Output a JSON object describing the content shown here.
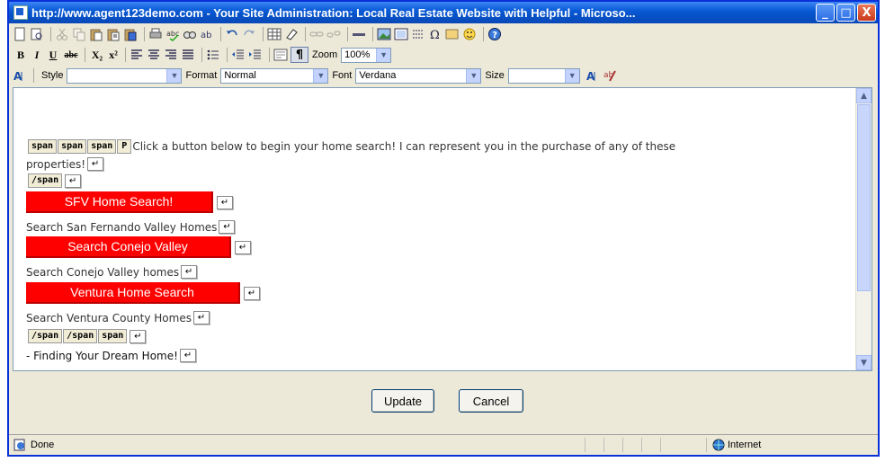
{
  "window": {
    "title": "http://www.agent123demo.com - Your Site Administration: Local Real Estate Website with Helpful  - Microso...",
    "minimize": "_",
    "maximize": "□",
    "close": "X"
  },
  "toolbar": {
    "bold": "B",
    "italic": "I",
    "underline": "U",
    "strike": "abc",
    "subscript": "X₂",
    "superscript": "x²",
    "pilcrow": "¶",
    "zoom_label": "Zoom",
    "zoom_value": "100%",
    "style_label": "Style",
    "style_value": "",
    "format_label": "Format",
    "format_value": "Normal",
    "font_label": "Font",
    "font_value": "Verdana",
    "size_label": "Size",
    "size_value": ""
  },
  "editor": {
    "tags_open": [
      "span",
      "span",
      "span"
    ],
    "intro_line1": "Click a button below to begin your home search! I can represent you in the purchase of any of these",
    "intro_line2": "properties!",
    "tag_close1": "/span",
    "buttons": [
      {
        "label": "SFV Home Search!",
        "caption": "Search San Fernando Valley Homes"
      },
      {
        "label": "Search Conejo Valley",
        "caption": "Search Conejo Valley homes"
      },
      {
        "label": "Ventura Home Search",
        "caption": "Search Ventura County Homes"
      }
    ],
    "tags_close": [
      "/span",
      "/span",
      "span"
    ],
    "dream_line": "- Finding Your Dream Home!"
  },
  "actions": {
    "update": "Update",
    "cancel": "Cancel"
  },
  "status": {
    "left": "Done",
    "zone": "Internet"
  }
}
